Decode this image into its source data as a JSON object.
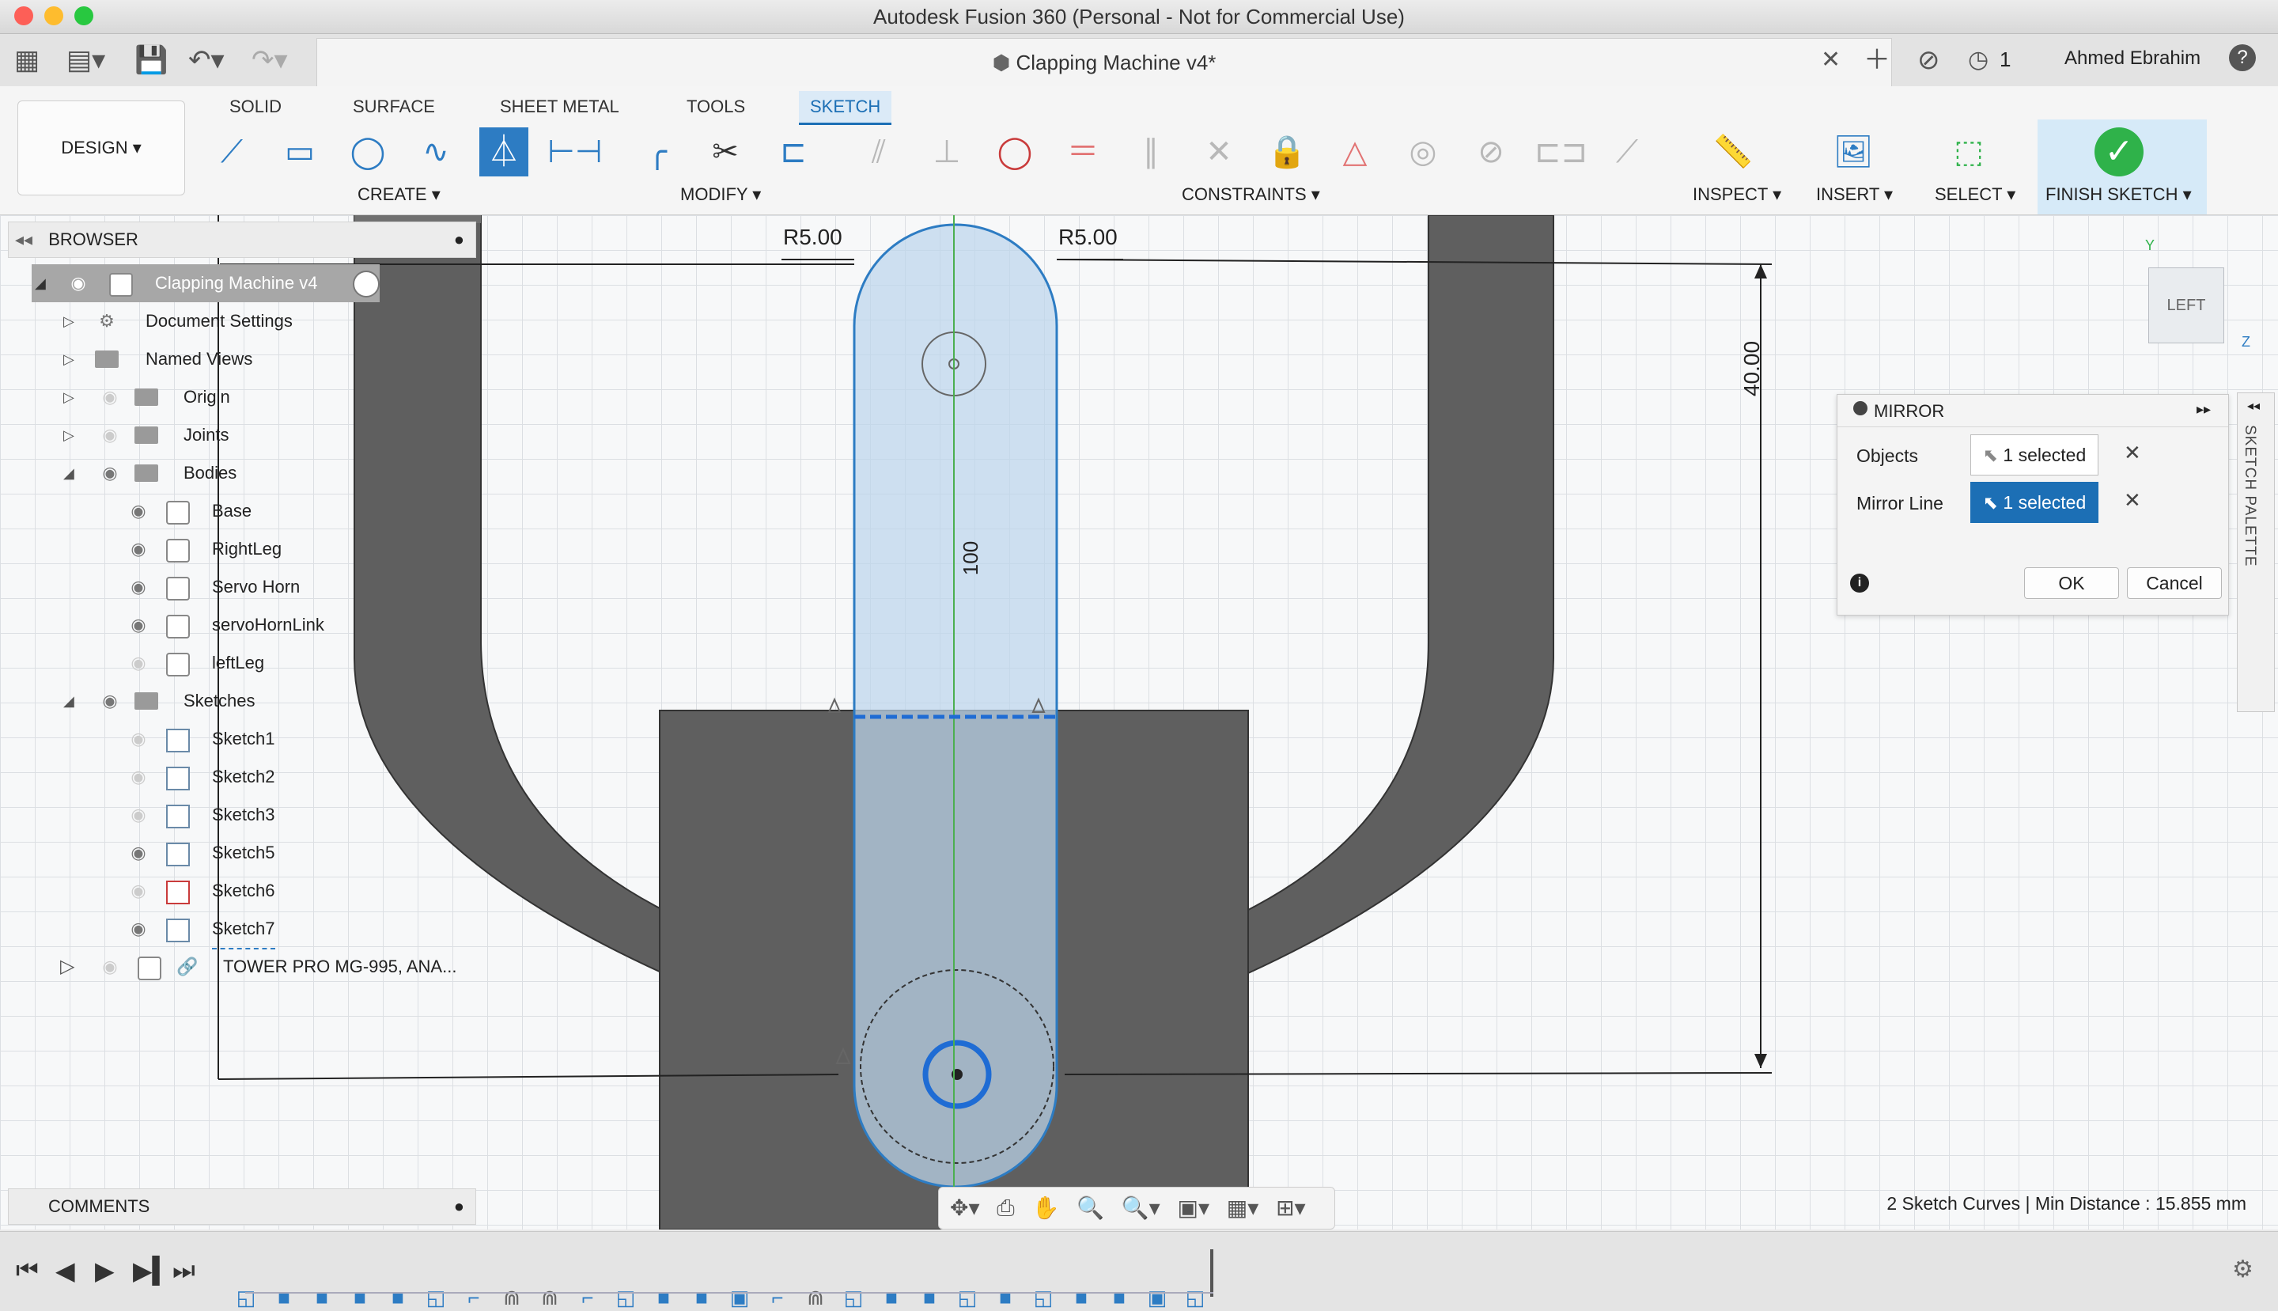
{
  "app": {
    "window_title": "Autodesk Fusion 360 (Personal - Not for Commercial Use)",
    "document_tab": "Clapping Machine v4*",
    "user_name": "Ahmed Ebrahim",
    "job_count": "1",
    "help": "?"
  },
  "ribbon": {
    "workspace": "DESIGN",
    "tabs": [
      {
        "label": "SOLID"
      },
      {
        "label": "SURFACE"
      },
      {
        "label": "SHEET METAL"
      },
      {
        "label": "TOOLS"
      },
      {
        "label": "SKETCH",
        "active": true
      }
    ],
    "groups": {
      "create": "CREATE",
      "modify": "MODIFY",
      "constraints": "CONSTRAINTS",
      "inspect": "INSPECT",
      "insert": "INSERT",
      "select": "SELECT",
      "finish": "FINISH SKETCH"
    }
  },
  "browser": {
    "header": "BROWSER",
    "tree": [
      {
        "label": "Clapping Machine v4",
        "level": 0
      },
      {
        "label": "Document Settings",
        "level": 1
      },
      {
        "label": "Named Views",
        "level": 1
      },
      {
        "label": "Origin",
        "level": 1
      },
      {
        "label": "Joints",
        "level": 1
      },
      {
        "label": "Bodies",
        "level": 1
      },
      {
        "label": "Base",
        "level": 2
      },
      {
        "label": "RightLeg",
        "level": 2
      },
      {
        "label": "Servo Horn",
        "level": 2
      },
      {
        "label": "servoHornLink",
        "level": 2
      },
      {
        "label": "leftLeg",
        "level": 2
      },
      {
        "label": "Sketches",
        "level": 1
      },
      {
        "label": "Sketch1",
        "level": 2
      },
      {
        "label": "Sketch2",
        "level": 2
      },
      {
        "label": "Sketch3",
        "level": 2
      },
      {
        "label": "Sketch5",
        "level": 2
      },
      {
        "label": "Sketch6",
        "level": 2
      },
      {
        "label": "Sketch7",
        "level": 2
      },
      {
        "label": "TOWER PRO MG-995, ANA...",
        "level": 1
      }
    ]
  },
  "canvas": {
    "dims": {
      "r_left": "R5.00",
      "r_right": "R5.00",
      "len_100": "100",
      "len_40": "40.00"
    },
    "viewcube_face": "LEFT",
    "axis_labels": {
      "y": "Y",
      "z": "Z"
    }
  },
  "mirror_dialog": {
    "title": "MIRROR",
    "objects_label": "Objects",
    "objects_value": "1 selected",
    "mirror_line_label": "Mirror Line",
    "mirror_line_value": "1 selected",
    "ok": "OK",
    "cancel": "Cancel"
  },
  "palette_label": "SKETCH PALETTE",
  "comments": {
    "header": "COMMENTS"
  },
  "status_bar": {
    "text": "2 Sketch Curves | Min Distance : 15.855 mm"
  },
  "colors": {
    "accent": "#1c6fb5",
    "sketch_fill": "#bcd6ec",
    "body": "#5f5f5f",
    "finish_check": "#2fb24a"
  }
}
